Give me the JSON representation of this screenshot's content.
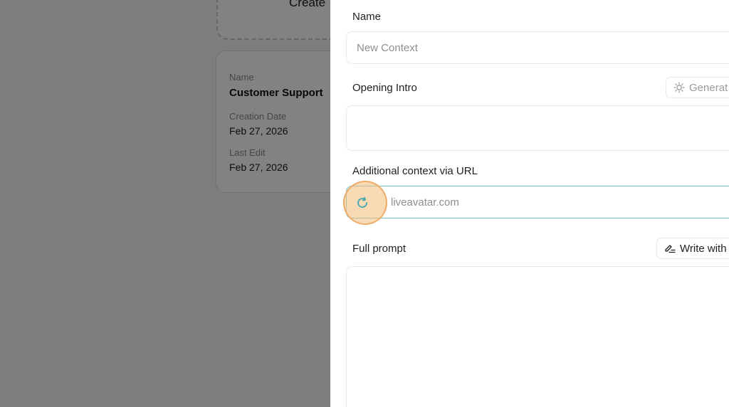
{
  "background": {
    "create_card": {
      "label": "Create"
    },
    "context_card": {
      "name_label": "Name",
      "name_value": "Customer Support",
      "creation_label": "Creation Date",
      "creation_value": "Feb 27, 2026",
      "edit_label": "Last Edit",
      "edit_value": "Feb 27, 2026"
    }
  },
  "panel": {
    "name": {
      "label": "Name",
      "placeholder": "New Context"
    },
    "opening_intro": {
      "label": "Opening Intro",
      "generate_button": "Generat",
      "value": ""
    },
    "url": {
      "label": "Additional context via URL",
      "value": "liveavatar.com"
    },
    "full_prompt": {
      "label": "Full prompt",
      "write_button": "Write with",
      "value": ""
    }
  },
  "colors": {
    "accent_teal": "#6dbdc4",
    "highlight_orange": "#f3bc78"
  },
  "icons": {
    "generate": "sparkle-sun-icon",
    "url_refresh": "refresh-icon",
    "write": "pen-lines-icon"
  }
}
